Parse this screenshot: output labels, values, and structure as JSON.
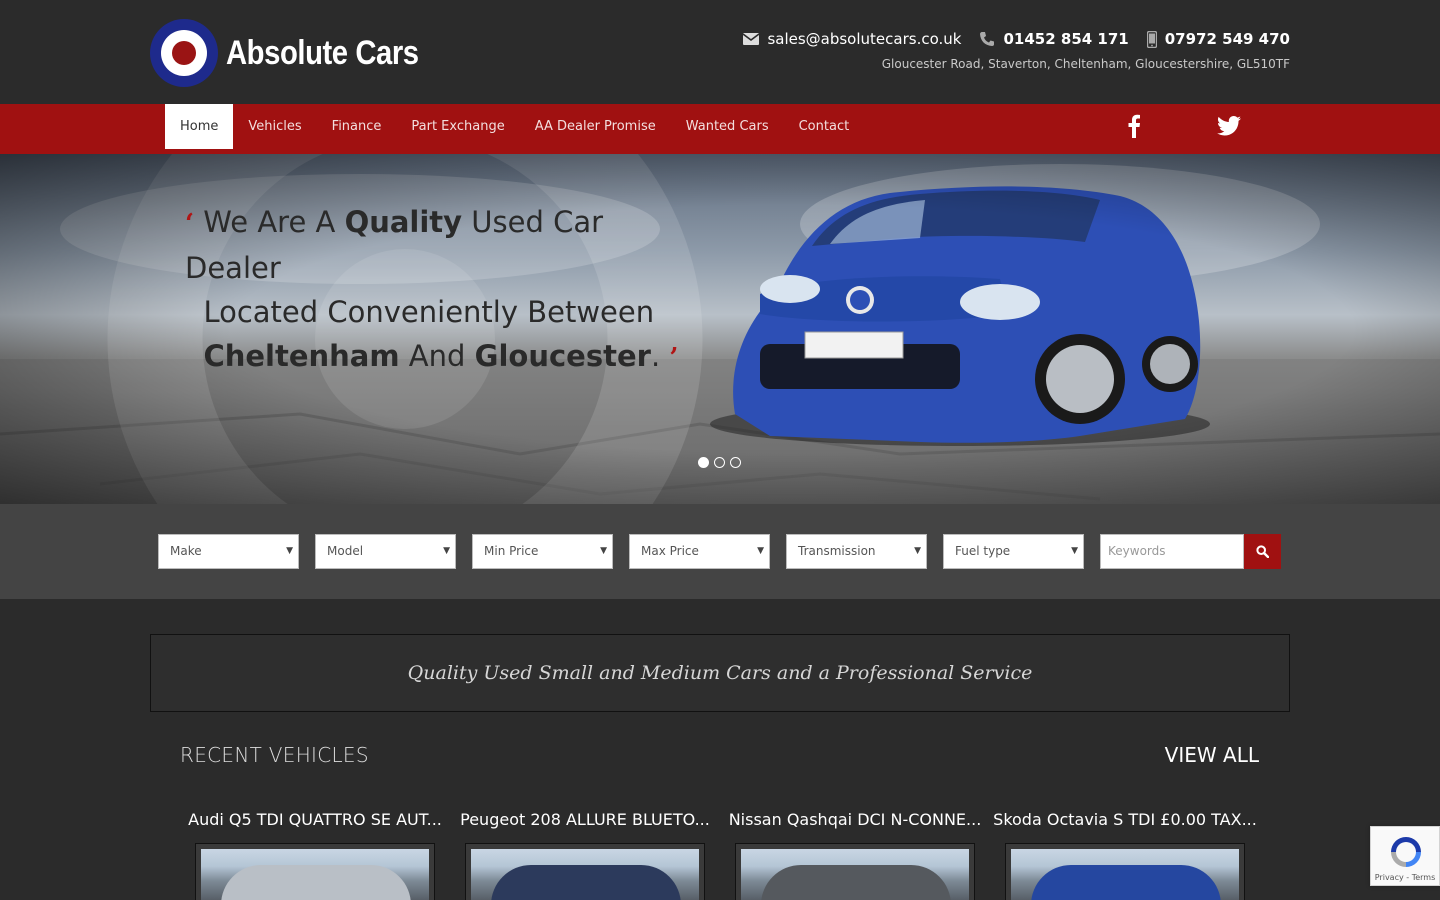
{
  "brand": {
    "name": "Absolute Cars",
    "accent": "#a01111",
    "roundel_blue": "#1e2a8c"
  },
  "header": {
    "email": "sales@absolutecars.co.uk",
    "phone": "01452 854 171",
    "mobile": "07972 549 470",
    "address": "Gloucester Road, Staverton, Cheltenham, Gloucestershire, GL510TF",
    "icons": [
      "envelope-icon",
      "phone-icon",
      "mobile-icon"
    ]
  },
  "nav": {
    "items": [
      {
        "label": "Home",
        "active": true
      },
      {
        "label": "Vehicles"
      },
      {
        "label": "Finance"
      },
      {
        "label": "Part Exchange"
      },
      {
        "label": "AA Dealer Promise"
      },
      {
        "label": "Wanted Cars"
      },
      {
        "label": "Contact"
      }
    ],
    "social": [
      "facebook-icon",
      "twitter-icon"
    ]
  },
  "hero": {
    "line1_a": "We Are A ",
    "line1_b": "Quality",
    "line1_c": " Used Car Dealer",
    "line2": "Located Conveniently Between",
    "line3_a": "Cheltenham",
    "line3_b": " And ",
    "line3_c": "Gloucester",
    "line3_d": ".",
    "open_quote": "‘",
    "close_quote": "’",
    "slides": 3,
    "active_slide": 1
  },
  "search": {
    "filters": [
      "Make",
      "Model",
      "Min Price",
      "Max Price",
      "Transmission",
      "Fuel type"
    ],
    "keywords_placeholder": "Keywords"
  },
  "tagline": "Quality Used Small and Medium Cars and a Professional Service",
  "recent": {
    "title": "RECENT VEHICLES",
    "view_all": "VIEW ALL",
    "vehicles": [
      {
        "title": "Audi Q5 TDI QUATTRO SE AUT...",
        "color": "#b9bfc6"
      },
      {
        "title": "Peugeot 208 ALLURE BLUETO...",
        "color": "#2c3a5c"
      },
      {
        "title": "Nissan Qashqai DCI N-CONNE...",
        "color": "#55595e"
      },
      {
        "title": "Skoda Octavia S TDI £0.00 TAX...",
        "color": "#2547a0"
      }
    ]
  },
  "recaptcha": {
    "label": "Privacy - Terms"
  }
}
